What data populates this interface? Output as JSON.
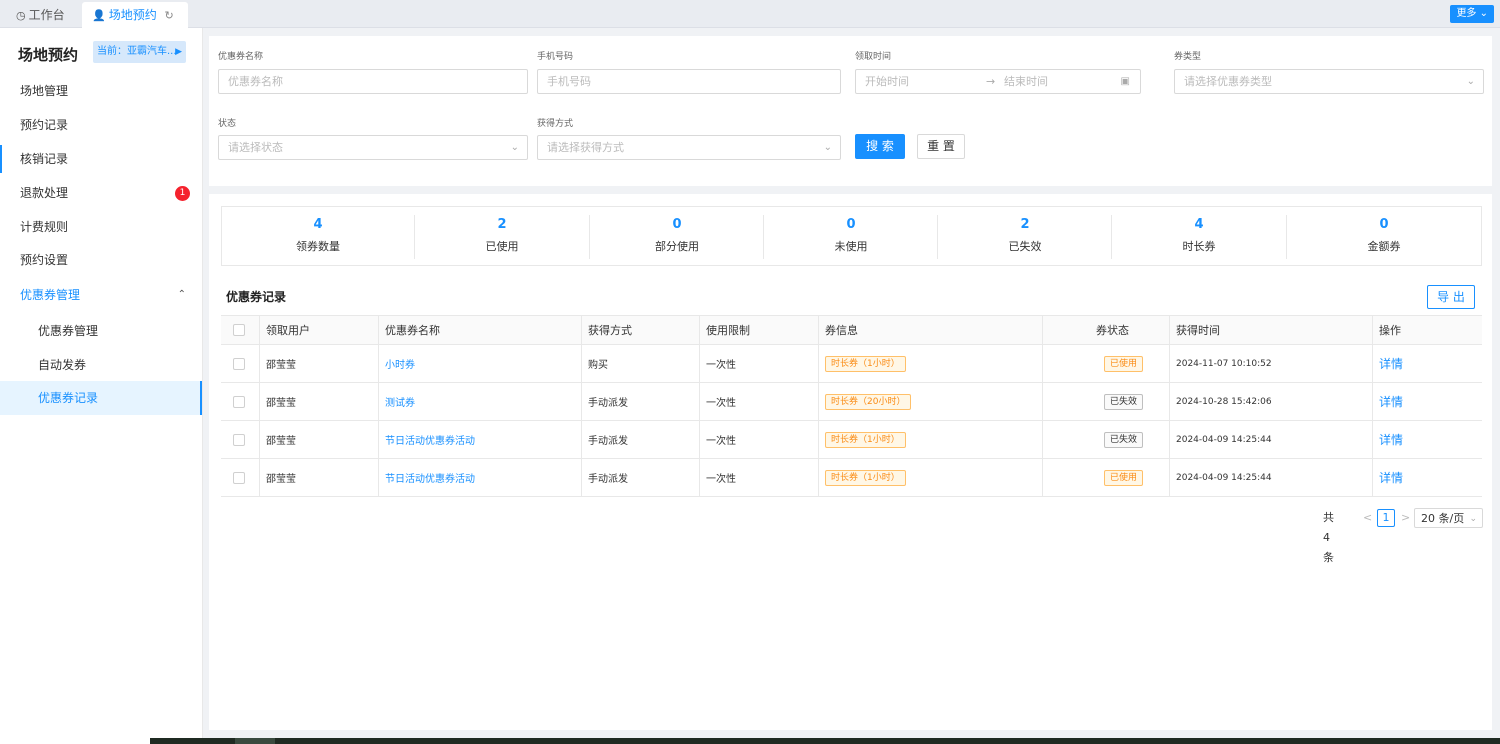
{
  "tabs": [
    {
      "label": "工作台",
      "icon": "dashboard-icon"
    },
    {
      "label": "场地预约",
      "icon": "user-icon",
      "active": true
    }
  ],
  "more_button": "更多",
  "sidebar": {
    "title": "场地预约",
    "current": "当前：亚霸汽车...",
    "items": [
      {
        "label": "场地管理"
      },
      {
        "label": "预约记录"
      },
      {
        "label": "核销记录"
      },
      {
        "label": "退款处理",
        "badge": "1"
      },
      {
        "label": "计费规则"
      },
      {
        "label": "预约设置"
      },
      {
        "label": "优惠券管理",
        "open": true
      },
      {
        "label": "优惠券管理",
        "sub": true
      },
      {
        "label": "自动发券",
        "sub": true
      },
      {
        "label": "优惠券记录",
        "sub": true,
        "active": true
      }
    ]
  },
  "filters": {
    "coupon_name": {
      "label": "优惠券名称",
      "placeholder": "优惠券名称"
    },
    "phone": {
      "label": "手机号码",
      "placeholder": "手机号码"
    },
    "time": {
      "label": "领取时间",
      "start": "开始时间",
      "sep": "→",
      "end": "结束时间"
    },
    "type": {
      "label": "券类型",
      "placeholder": "请选择优惠券类型"
    },
    "status": {
      "label": "状态",
      "placeholder": "请选择状态"
    },
    "method": {
      "label": "获得方式",
      "placeholder": "请选择获得方式"
    },
    "search_label": "搜 索",
    "reset_label": "重 置"
  },
  "stats": [
    {
      "value": "4",
      "label": "领券数量"
    },
    {
      "value": "2",
      "label": "已使用"
    },
    {
      "value": "0",
      "label": "部分使用"
    },
    {
      "value": "0",
      "label": "未使用"
    },
    {
      "value": "2",
      "label": "已失效"
    },
    {
      "value": "4",
      "label": "时长券"
    },
    {
      "value": "0",
      "label": "金额券"
    }
  ],
  "section_title": "优惠券记录",
  "export_label": "导 出",
  "table": {
    "columns": [
      "领取用户",
      "优惠券名称",
      "获得方式",
      "使用限制",
      "券信息",
      "券状态",
      "获得时间",
      "操作"
    ],
    "rows": [
      {
        "user": "邵莹莹",
        "name": "小时券",
        "method": "购买",
        "limit": "一次性",
        "info": "时长券（1小时）",
        "status": "已使用",
        "time": "2024-11-07 10:10:52",
        "op": "详情"
      },
      {
        "user": "邵莹莹",
        "name": "测试券",
        "method": "手动派发",
        "limit": "一次性",
        "info": "时长券（20小时）",
        "status": "已失效",
        "time": "2024-10-28 15:42:06",
        "op": "详情"
      },
      {
        "user": "邵莹莹",
        "name": "节日活动优惠券活动",
        "method": "手动派发",
        "limit": "一次性",
        "info": "时长券（1小时）",
        "status": "已失效",
        "time": "2024-04-09 14:25:44",
        "op": "详情"
      },
      {
        "user": "邵莹莹",
        "name": "节日活动优惠券活动",
        "method": "手动派发",
        "limit": "一次性",
        "info": "时长券（1小时）",
        "status": "已使用",
        "time": "2024-04-09 14:25:44",
        "op": "详情"
      }
    ]
  },
  "pagination": {
    "total": "共4条",
    "prev": "<",
    "current": "1",
    "next": ">",
    "page_size": "20 条/页"
  },
  "colors": {
    "accent": "#1890ff",
    "used_tag": "#fa8c16",
    "badge": "#f5222d"
  }
}
